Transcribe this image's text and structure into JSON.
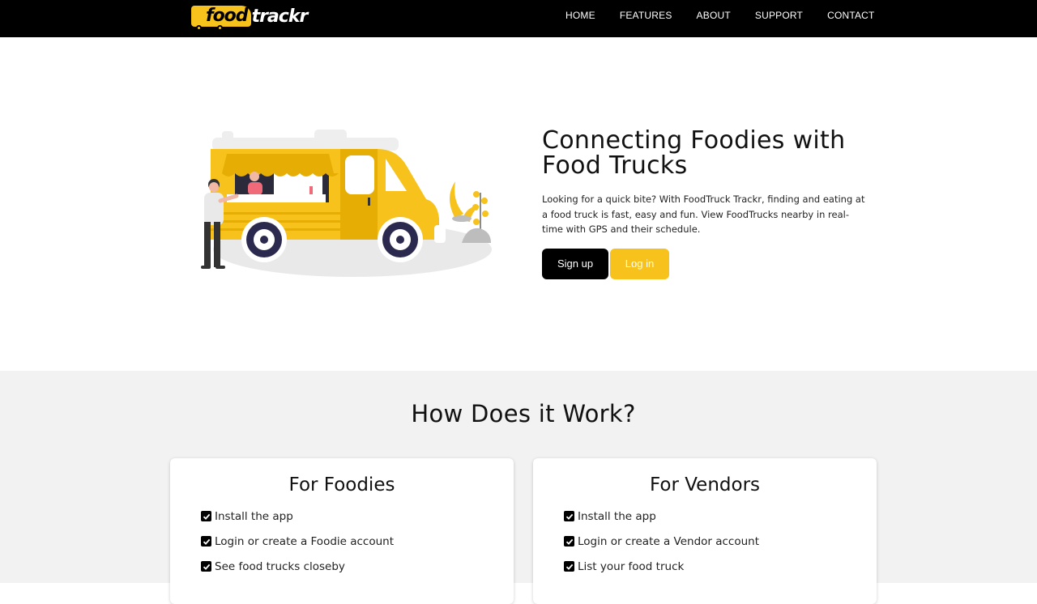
{
  "brand": {
    "logo_part1": "food",
    "logo_part2": "trackr",
    "accent_color": "#f7c21c"
  },
  "nav": {
    "links": [
      {
        "label": "HOME"
      },
      {
        "label": "FEATURES"
      },
      {
        "label": "ABOUT"
      },
      {
        "label": "SUPPORT"
      },
      {
        "label": "CONTACT"
      }
    ]
  },
  "hero": {
    "illustration": "food-truck-illustration",
    "title": "Connecting Foodies with Food Trucks",
    "description": "Looking for a quick bite? With FoodTruck Trackr, finding and eating at a food truck is fast, easy and fun. View FoodTrucks nearby in real-time with GPS and their schedule.",
    "signup_label": "Sign up",
    "login_label": "Log in"
  },
  "how": {
    "title": "How Does it Work?",
    "cards": [
      {
        "title": "For Foodies",
        "items": [
          "Install the app",
          "Login or create a Foodie account",
          "See food trucks closeby"
        ]
      },
      {
        "title": "For Vendors",
        "items": [
          "Install the app",
          "Login or create a Vendor account",
          "List your food truck"
        ]
      }
    ]
  }
}
